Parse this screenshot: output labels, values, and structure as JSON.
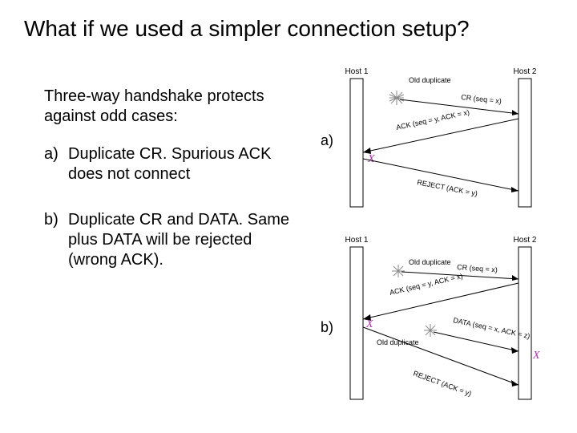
{
  "title": "What if we used a simpler connection setup?",
  "subtitle": "Three-way handshake protects against odd cases:",
  "items": {
    "a": {
      "marker": "a)",
      "text": "Duplicate CR. Spurious ACK does not connect"
    },
    "b": {
      "marker": "b)",
      "text": "Duplicate CR and DATA. Same plus DATA will be rejected (wrong ACK)."
    }
  },
  "diagramLabels": {
    "a": "a)",
    "b": "b)"
  },
  "diagramA": {
    "host1": "Host 1",
    "host2": "Host 2",
    "oldDup": "Old duplicate",
    "msg1": "CR (seq = x)",
    "msg2": "ACK (seq = y, ACK = x)",
    "msg3": "REJECT (ACK = y)",
    "x1": "X"
  },
  "diagramB": {
    "host1": "Host 1",
    "host2": "Host 2",
    "oldDup1": "Old duplicate",
    "oldDup2": "Old duplicate",
    "msg1": "CR (seq = x)",
    "msg2": "ACK (seq = y, ACK = x)",
    "msg3": "DATA (seq = x, ACK = z)",
    "msg4": "REJECT (ACK = y)",
    "x1": "X",
    "x2": "X"
  }
}
